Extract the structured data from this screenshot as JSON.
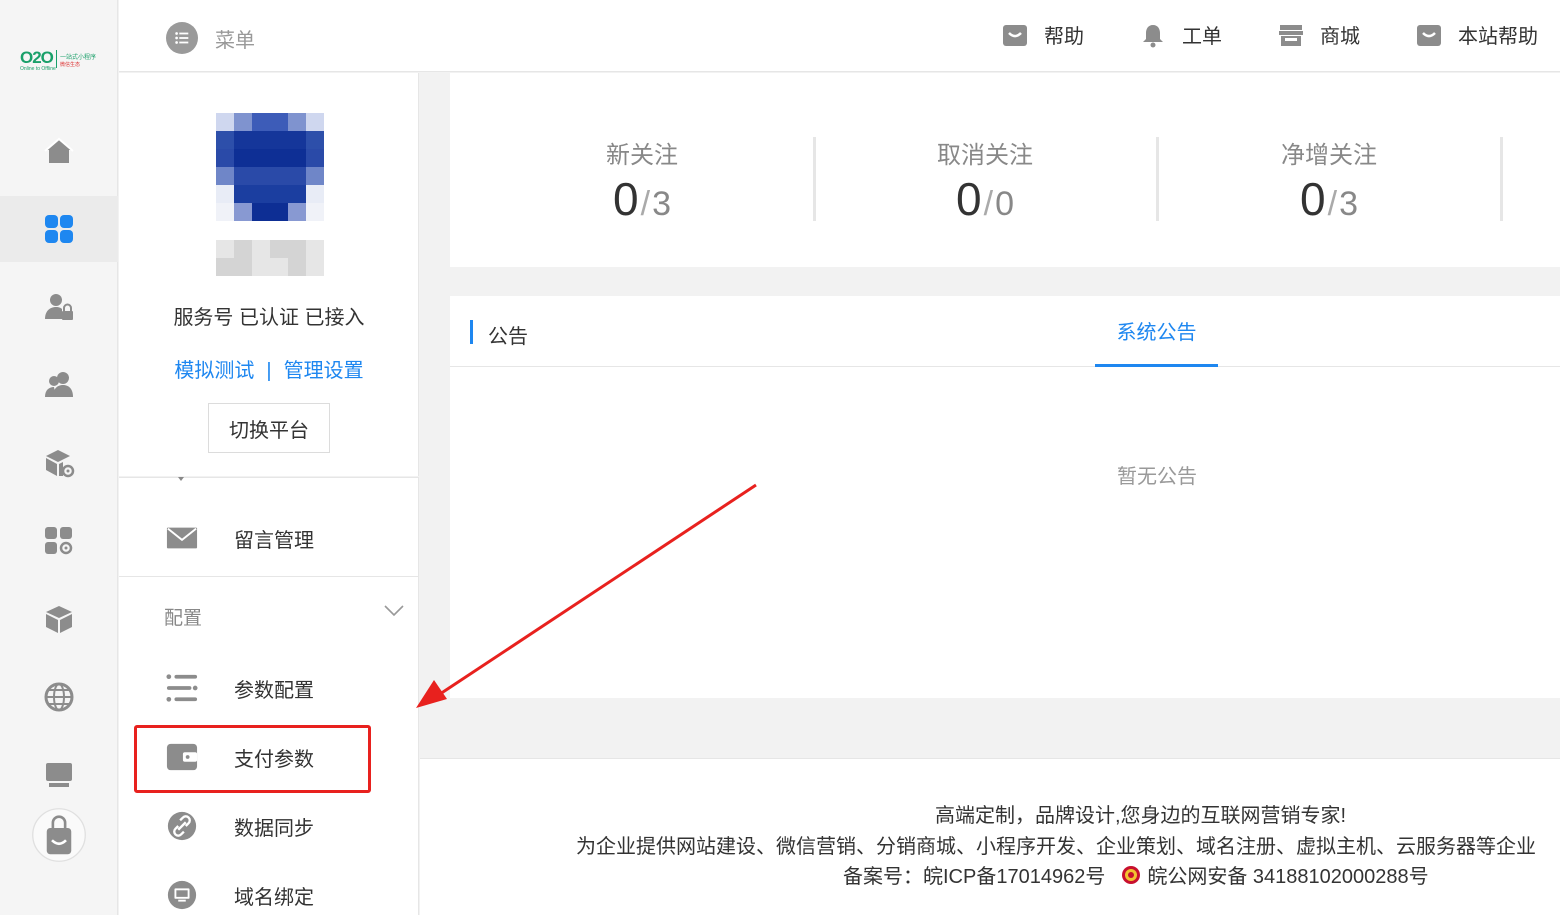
{
  "rail": {
    "logo_main": "O2O",
    "logo_sub": "Online to Offline",
    "logo_cn": "一站式小程序",
    "logo_cn2": "微信生态"
  },
  "header": {
    "menu_label": "菜单",
    "links": [
      {
        "label": "帮助",
        "icon": "bag-icon"
      },
      {
        "label": "工单",
        "icon": "bell-icon"
      },
      {
        "label": "商城",
        "icon": "store-icon"
      },
      {
        "label": "本站帮助",
        "icon": "bag-icon"
      }
    ]
  },
  "account": {
    "status": "服务号 已认证 已接入",
    "link_test": "模拟测试",
    "link_sep": "|",
    "link_manage": "管理设置",
    "switch_button": "切换平台"
  },
  "sidemenu": {
    "message_label": "留言管理",
    "group_label": "配置",
    "items": [
      {
        "label": "参数配置",
        "icon": "list-icon"
      },
      {
        "label": "支付参数",
        "icon": "wallet-icon"
      },
      {
        "label": "数据同步",
        "icon": "link-icon"
      },
      {
        "label": "域名绑定",
        "icon": "domain-icon"
      }
    ]
  },
  "stats": [
    {
      "title": "新关注",
      "value": "0",
      "total": "3"
    },
    {
      "title": "取消关注",
      "value": "0",
      "total": "0"
    },
    {
      "title": "净增关注",
      "value": "0",
      "total": "3"
    }
  ],
  "stats_slash": "/",
  "notice": {
    "title": "公告",
    "tab": "系统公告",
    "empty": "暂无公告"
  },
  "footer": {
    "line1": "高端定制，品牌设计,您身边的互联网营销专家!",
    "line2": "为企业提供网站建设、微信营销、分销商城、小程序开发、企业策划、域名注册、虚拟主机、云服务器等企业",
    "icp": "备案号：皖ICP备17014962号",
    "police": "皖公网安备 34188102000288号"
  },
  "colors": {
    "accent": "#1e87f0",
    "highlight": "#e8211e",
    "logo_green": "#1aa06a"
  }
}
